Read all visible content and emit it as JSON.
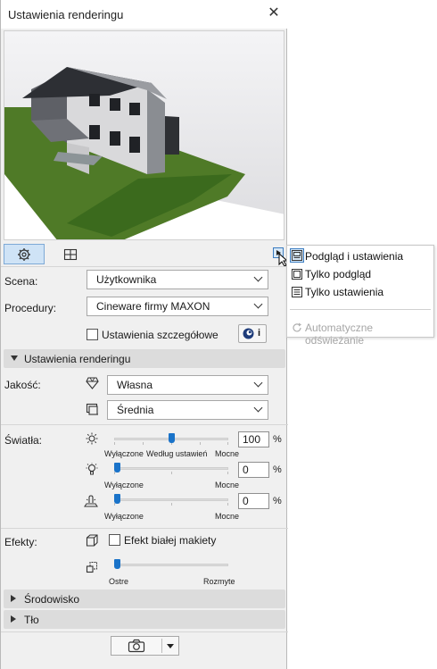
{
  "window": {
    "title": "Ustawienia renderingu"
  },
  "menu": {
    "items": [
      "Podgląd i ustawienia",
      "Tylko podgląd",
      "Tylko ustawienia"
    ],
    "auto_refresh": "Automatyczne odświeżanie"
  },
  "scene": {
    "label": "Scena:",
    "value": "Użytkownika"
  },
  "procedures": {
    "label": "Procedury:",
    "value": "Cineware firmy MAXON"
  },
  "detail": {
    "label": "Ustawienia szczegółowe",
    "info": "i"
  },
  "render_section": {
    "title": "Ustawienia renderingu"
  },
  "quality": {
    "label": "Jakość:",
    "value1": "Własna",
    "value2": "Średnia"
  },
  "lights": {
    "label": "Światła:",
    "slider1": {
      "min": "Wyłączone",
      "mid": "Według ustawień",
      "max": "Mocne",
      "value": "100",
      "unit": "%"
    },
    "slider2": {
      "min": "Wyłączone",
      "max": "Mocne",
      "value": "0",
      "unit": "%"
    },
    "slider3": {
      "min": "Wyłączone",
      "max": "Mocne",
      "value": "0",
      "unit": "%"
    }
  },
  "effects": {
    "label": "Efekty:",
    "white_model": "Efekt białej makiety",
    "min": "Ostre",
    "max": "Rozmyte"
  },
  "env_section": {
    "title": "Środowisko"
  },
  "bg_section": {
    "title": "Tło"
  },
  "colors": {
    "accent": "#1a73c9",
    "active_tab": "#cfe3f6",
    "grass": "#3d6a1f"
  }
}
